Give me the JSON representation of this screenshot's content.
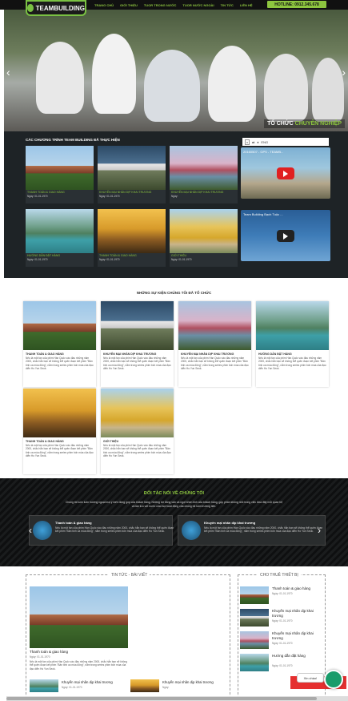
{
  "header": {
    "logo_text": "TEAMBUILDING",
    "nav": [
      "TRANG CHỦ",
      "GIỚI THIỆU",
      "TUOR TRONG NƯỚC",
      "TUOR NƯỚC NGOÀI",
      "TIN TỨC",
      "LIÊN HỆ"
    ],
    "hotline": "HOTLINE: 0912.345.678"
  },
  "hero": {
    "caption_prefix": "TỔ CHỨC",
    "caption_highlight": "CHUYÊN NGHIỆP",
    "prev_icon": "‹",
    "next_icon": "›"
  },
  "programs": {
    "title": "CÁC CHƯƠNG TRÌNH TEAM BUILDING ĐÃ THỰC HIỆN",
    "items": [
      {
        "title": "THANH TOÁN & GIAO HÀNG",
        "date": "Ngày: 01-01-1970",
        "img": "church"
      },
      {
        "title": "KHUYẾN MẠI NHÂN DỊP KHAI TRƯƠNG",
        "date": "Ngày: 01-01-1970",
        "img": "monu"
      },
      {
        "title": "KHUYẾN MẠI NHÂN DỊP KHAI TRƯƠNG",
        "date": "Ngày:",
        "img": "pagoda"
      },
      {
        "title": "HƯỚNG DẪN ĐẶT HÀNG",
        "date": "Ngày: 01-01-1970",
        "img": "bay"
      },
      {
        "title": "THANH TOÁN & GIAO HÀNG",
        "date": "Ngày: 01-01-1970",
        "img": "autumn"
      },
      {
        "title": "GIỚI THIỆU",
        "date": "Ngày: 01-01-1970",
        "img": "tree"
      }
    ],
    "controls": {
      "close": "x",
      "label": "ENG"
    },
    "videos": [
      {
        "title": "20160507 - GPS - TEAMB..."
      },
      {
        "title": "Team Building Bạch Tuộc ..."
      }
    ]
  },
  "events": {
    "title": "NHỮNG SỰ KIỆN CHÚNG TÔI ĐÃ TỔ CHỨC",
    "desc": "Nếu là một fan của phim Hàn Quốc vào đầu những năm 2000, chắc hẳn bạn sẽ không thể quên đoạn kết phim \"Bản tình ca mùa đông\", nằm trong series phim bốn mùa của đạo diễn Ho Yun Seok.",
    "items": [
      {
        "title": "THANH TOÁN & GIAO HÀNG",
        "img": "church"
      },
      {
        "title": "KHUYẾN MẠI NHÂN DỊP KHAI TRƯƠNG",
        "img": "monu"
      },
      {
        "title": "KHUYẾN MẠI NHÂN DỊP KHAI TRƯƠNG",
        "img": "pagoda"
      },
      {
        "title": "HƯỚNG DẪN ĐẶT HÀNG",
        "img": "bay"
      },
      {
        "title": "THANH TOÁN & GIAO HÀNG",
        "img": "autumn"
      },
      {
        "title": "GIỚI THIỆU",
        "img": "tree"
      }
    ]
  },
  "partners": {
    "title": "ĐỐI TÁC NÓI VỀ CHÚNG TÔI",
    "subtitle": "Chúng tôi luôn luôn hướng ngoại mọi ý kiến đóng góp của khách hàng. Những bờ đóng vấn và ngợi khen tinh của khách hàng, góp phần không nhỏ trong việc đưa đẩy mỗi quan hệ và lần lưu với nước của mọi hoạt động của chúng tôi luôn trường tiến.",
    "items": [
      {
        "name": "Thanh toán & giao hàng",
        "desc": "Nếu là một fan của phim Hàn Quốc vào đầu những năm 2000, chắc hẳn bạn sẽ không thể quên đoạn kết phim \"Bản tình ca mùa đông\", nằm trong series phim bốn mùa của đạo diễn Ho Yun Seok."
      },
      {
        "name": "Khuyến mại nhân dịp khai trương",
        "desc": "Nếu là một fan của phim Hàn Quốc vào đầu những năm 2000, chắc hẳn bạn sẽ không thể quên đoạn kết phim \"Bản tình ca mùa đông\", nằm trong series phim bốn mùa của đạo diễn Ho Yun Seok."
      }
    ]
  },
  "news": {
    "title": "TIN TỨC - BÀI VIẾT",
    "main": {
      "title": "Thanh toán & giao hàng",
      "date": "Ngày: 01-01-1970",
      "desc": "Nếu là một fan của phim Hàn Quốc vào đầu những năm 2000, chắc hẳn bạn sẽ không thể quên đoạn kết phim \"Bản tình ca mùa đông\", nằm trong series phim bốn mùa của đạo diễn Ho Yun Seok."
    },
    "small": [
      {
        "title": "Khuyến mại nhân dịp khai trương",
        "date": "Ngày: 01-01-1970"
      },
      {
        "title": "Khuyến mại nhân dịp khai trương",
        "date": "Ngày:"
      }
    ]
  },
  "rent": {
    "title": "CHO THUÊ THIẾT BỊ",
    "items": [
      {
        "title": "Thanh toán & giao hàng",
        "date": "Ngày: 01-01-1970",
        "img": "church"
      },
      {
        "title": "Khuyến mại nhân dịp khai trương",
        "date": "Ngày: 01-01-1970",
        "img": "monu"
      },
      {
        "title": "Khuyến mại nhân dịp khai trương",
        "date": "Ngày: 01-01-1970",
        "img": "pagoda"
      },
      {
        "title": "Hướng dẫn đặt hàng",
        "date": "Ngày: 01-01-1970",
        "img": "bay"
      }
    ]
  },
  "chat": {
    "label": "Xin chào!"
  }
}
